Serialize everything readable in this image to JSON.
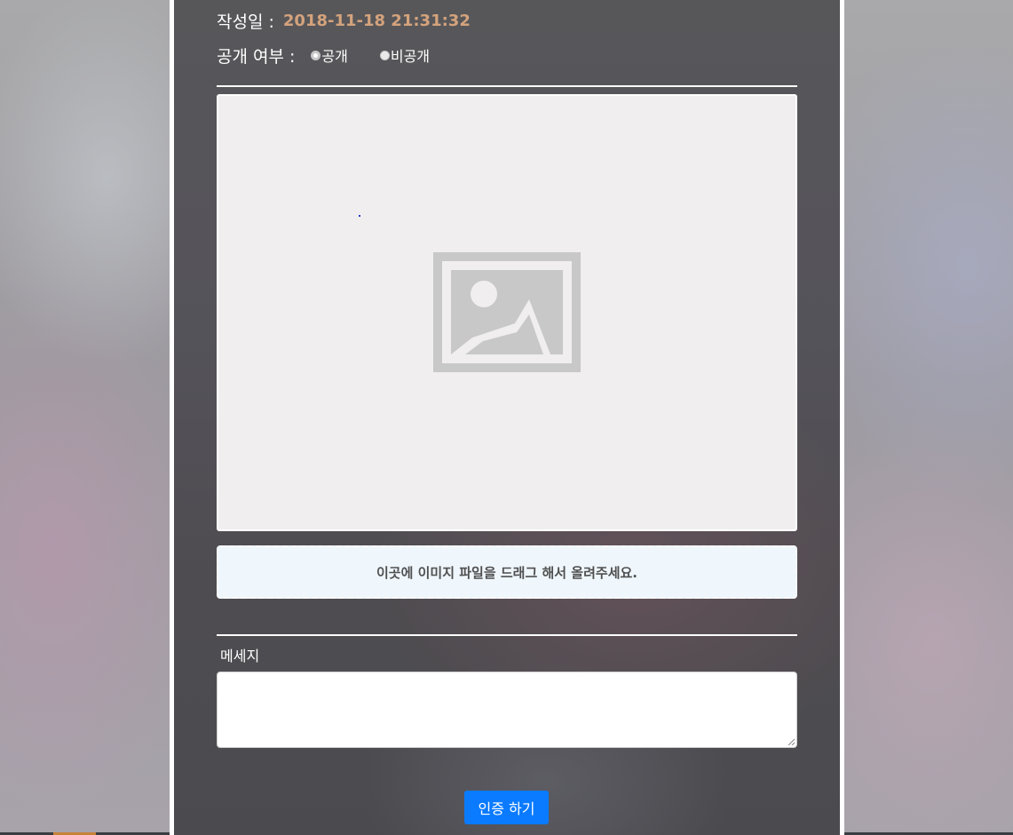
{
  "post": {
    "date_label": "작성일 :",
    "date_value": "2018-11-18 21:31:32",
    "visibility_label": "공개 여부 :",
    "visibility_options": [
      {
        "label": "공개",
        "checked": true
      },
      {
        "label": "비공개",
        "checked": false
      }
    ]
  },
  "image_area": {
    "placeholder_icon": "image-placeholder-icon"
  },
  "dropzone": {
    "text": "이곳에 이미지 파일을 드래그 해서 올려주세요."
  },
  "message": {
    "label": "메세지",
    "value": ""
  },
  "submit": {
    "label": "인증 하기"
  },
  "colors": {
    "accent": "#0a7bff",
    "date": "#d4a37c",
    "dropzone_bg": "#eff6fc"
  }
}
